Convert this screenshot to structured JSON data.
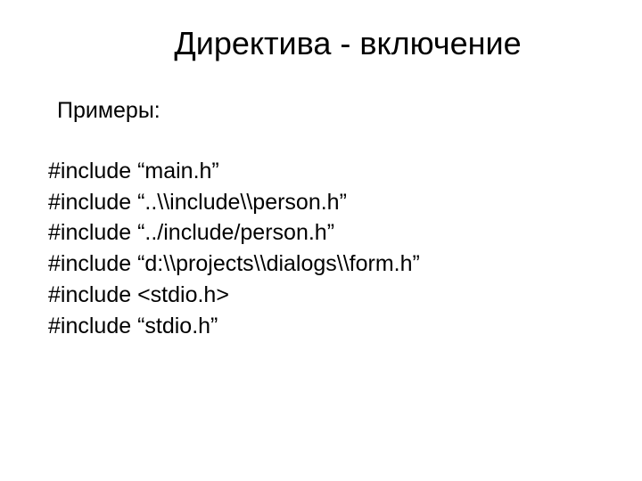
{
  "title": "Директива - включение",
  "subheading": "Примеры:",
  "lines": [
    "#include “main.h”",
    "#include “..\\\\include\\\\person.h”",
    "#include “../include/person.h”",
    "#include “d:\\\\projects\\\\dialogs\\\\form.h”",
    "#include <stdio.h>",
    "#include “stdio.h”"
  ]
}
